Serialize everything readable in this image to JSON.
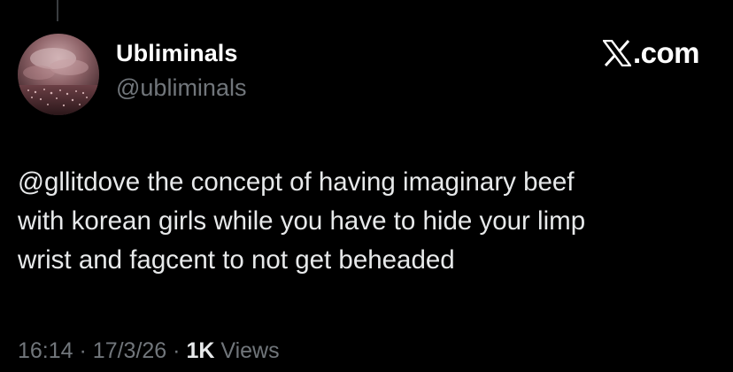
{
  "header": {
    "display_name": "Ubliminals",
    "handle": "@ubliminals",
    "brand_text": ".com",
    "brand_icon": "x-logo-icon"
  },
  "tweet": {
    "text": "@gllitdove the concept of having imaginary beef\nwith korean girls while you have to hide your limp\nwrist and fagcent to not get beheaded"
  },
  "meta": {
    "time": "16:14",
    "separator": "·",
    "date": "17/3/26",
    "views_count": "1K",
    "views_label": "Views"
  },
  "colors": {
    "background": "#000000",
    "primary_text": "#e7e9ea",
    "secondary_text": "#71767b",
    "name_text": "#ffffff"
  }
}
